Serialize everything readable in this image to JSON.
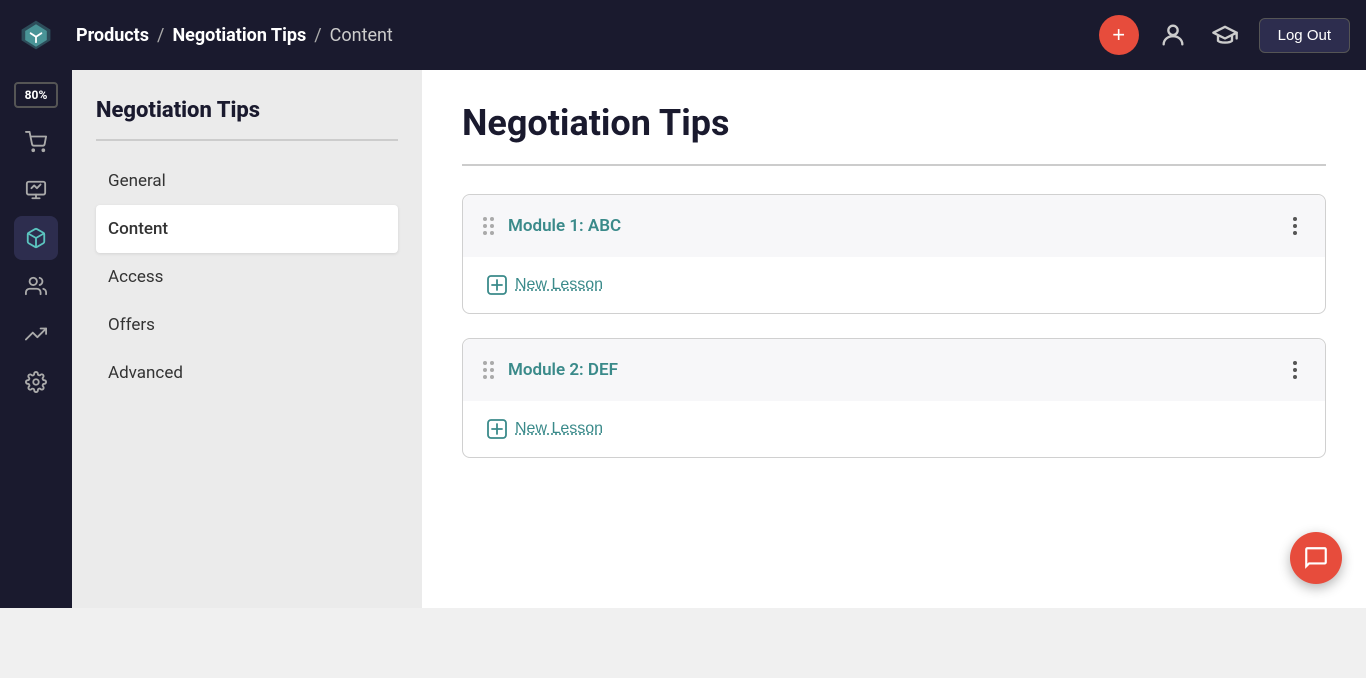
{
  "topnav": {
    "breadcrumb": {
      "products_label": "Products",
      "sep1": "/",
      "negotiation_tips_label": "Negotiation Tips",
      "sep2": "/",
      "content_label": "Content"
    },
    "add_button_label": "+",
    "logout_label": "Log Out"
  },
  "left_sidebar": {
    "progress": "80%",
    "icons": [
      {
        "name": "cart-icon",
        "title": "Cart"
      },
      {
        "name": "analytics-icon",
        "title": "Analytics"
      },
      {
        "name": "products-icon",
        "title": "Products"
      },
      {
        "name": "users-icon",
        "title": "Users"
      },
      {
        "name": "trends-icon",
        "title": "Trends"
      },
      {
        "name": "settings-icon",
        "title": "Settings"
      }
    ]
  },
  "left_nav": {
    "title": "Negotiation Tips",
    "items": [
      {
        "label": "General",
        "active": false
      },
      {
        "label": "Content",
        "active": true
      },
      {
        "label": "Access",
        "active": false
      },
      {
        "label": "Offers",
        "active": false
      },
      {
        "label": "Advanced",
        "active": false
      }
    ]
  },
  "content": {
    "page_title": "Negotiation Tips",
    "modules": [
      {
        "id": "module1",
        "title": "Module 1: ABC",
        "new_lesson_label": "New Lesson"
      },
      {
        "id": "module2",
        "title": "Module 2: DEF",
        "new_lesson_label": "New Lesson"
      }
    ]
  }
}
